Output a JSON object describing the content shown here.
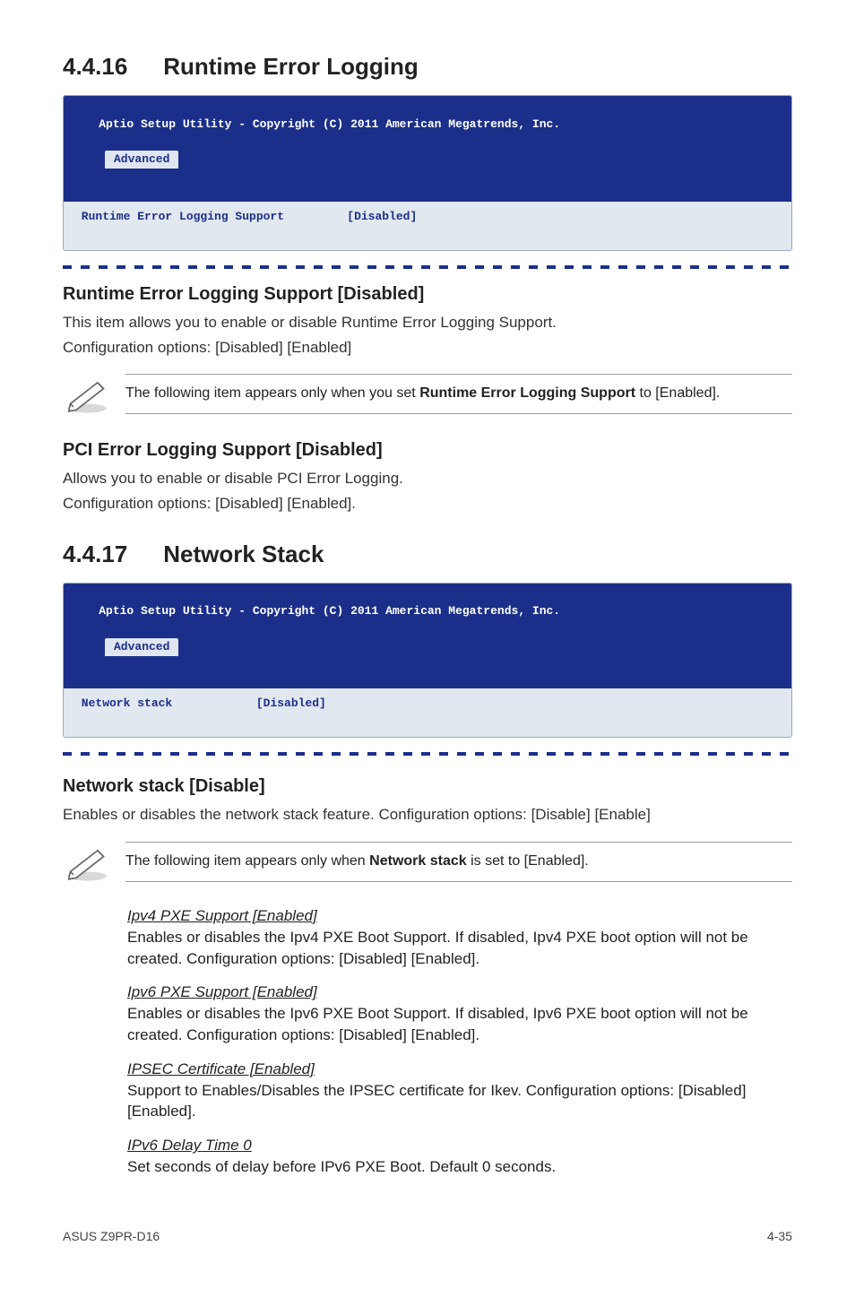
{
  "sec_4_16": {
    "num": "4.4.16",
    "title": "Runtime Error Logging",
    "bios": {
      "header": "Aptio Setup Utility - Copyright (C) 2011 American Megatrends, Inc.",
      "tab": "Advanced",
      "row_left": " Runtime Error Logging Support",
      "row_right": "[Disabled]"
    },
    "s1": {
      "title": "Runtime Error Logging Support [Disabled]",
      "p1": "This item allows you to enable or disable Runtime Error Logging Support.",
      "p2": "Configuration options: [Disabled] [Enabled]"
    },
    "note1a": "The following item appears only when you set ",
    "note1b": "Runtime Error Logging Support",
    "note1c": " to [Enabled].",
    "s2": {
      "title": "PCI Error Logging Support [Disabled]",
      "p1": "Allows you to enable or disable PCI Error Logging.",
      "p2": "Configuration options: [Disabled] [Enabled]."
    }
  },
  "sec_4_17": {
    "num": "4.4.17",
    "title": "Network Stack",
    "bios": {
      "header": "Aptio Setup Utility - Copyright (C) 2011 American Megatrends, Inc.",
      "tab": "Advanced",
      "row_left": " Network stack",
      "row_right": "[Disabled]"
    },
    "s1": {
      "title": "Network stack [Disable]",
      "p1": "Enables or disables the network stack feature. Configuration options: [Disable] [Enable]"
    },
    "note2a": "The following item appears only when ",
    "note2b": "Network stack",
    "note2c": " is set to [Enabled].",
    "items": {
      "i1": {
        "t": "Ipv4 PXE Support [Enabled]",
        "d": "Enables or disables the Ipv4 PXE Boot Support. If disabled, Ipv4 PXE boot option will not be created. Configuration options: [Disabled] [Enabled]."
      },
      "i2": {
        "t": "Ipv6 PXE Support [Enabled]",
        "d": "Enables or disables the Ipv6 PXE Boot Support. If disabled, Ipv6 PXE boot option will not be created. Configuration options: [Disabled] [Enabled]."
      },
      "i3": {
        "t": "IPSEC Certificate [Enabled]",
        "d": "Support to Enables/Disables the IPSEC certificate for Ikev. Configuration options: [Disabled] [Enabled]."
      },
      "i4": {
        "t": "IPv6 Delay Time 0",
        "d": "Set seconds of delay before IPv6 PXE Boot. Default 0 seconds."
      }
    }
  },
  "footer": {
    "left": "ASUS Z9PR-D16",
    "right": "4-35"
  }
}
